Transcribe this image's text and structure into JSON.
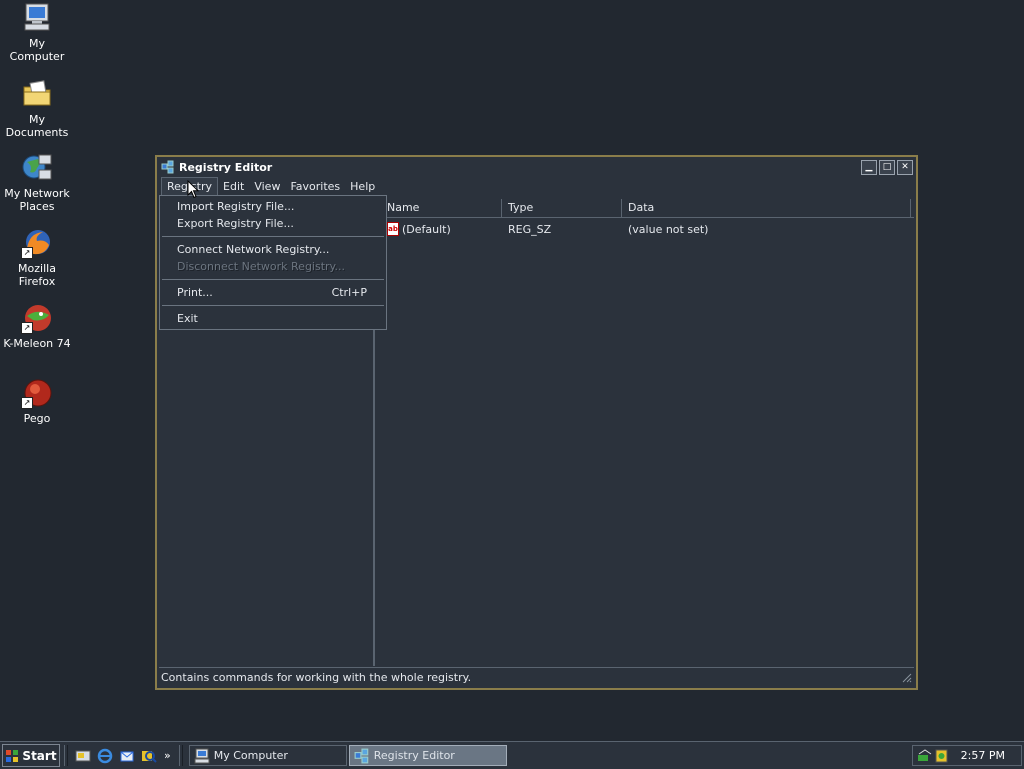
{
  "desktop": {
    "icons": [
      {
        "label": "My Computer"
      },
      {
        "label": "My Documents"
      },
      {
        "label": "My Network Places"
      },
      {
        "label": "Mozilla Firefox"
      },
      {
        "label": "K-Meleon 74"
      },
      {
        "label": "Pego"
      }
    ]
  },
  "window": {
    "title": "Registry Editor",
    "menu": [
      "Registry",
      "Edit",
      "View",
      "Favorites",
      "Help"
    ],
    "list": {
      "columns": [
        "Name",
        "Type",
        "Data"
      ],
      "rows": [
        {
          "name": "(Default)",
          "type": "REG_SZ",
          "data": "(value not set)"
        }
      ]
    },
    "status": "Contains commands for working with the whole registry."
  },
  "dropdown": {
    "items": [
      {
        "label": "Import Registry File...",
        "shortcut": "",
        "disabled": false
      },
      {
        "label": "Export Registry File...",
        "shortcut": "",
        "disabled": false
      },
      {
        "label": "Connect Network Registry...",
        "shortcut": "",
        "disabled": false
      },
      {
        "label": "Disconnect Network Registry...",
        "shortcut": "",
        "disabled": true
      },
      {
        "label": "Print...",
        "shortcut": "Ctrl+P",
        "disabled": false
      },
      {
        "label": "Exit",
        "shortcut": "",
        "disabled": false
      }
    ]
  },
  "taskbar": {
    "start_label": "Start",
    "quick_launch_more": "»",
    "tasks": [
      {
        "label": "My Computer",
        "active": false
      },
      {
        "label": "Registry Editor",
        "active": true
      }
    ],
    "clock": "2:57 PM"
  }
}
